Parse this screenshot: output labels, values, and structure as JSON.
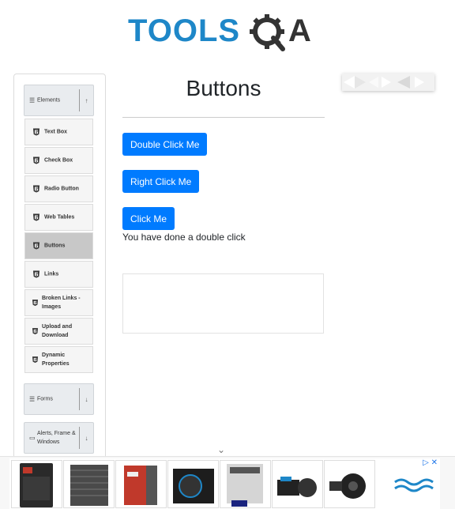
{
  "logo": {
    "text": "TOOLSQA"
  },
  "sidebar": {
    "groups": [
      {
        "label": "Elements",
        "toggle": "↑"
      },
      {
        "label": "Forms",
        "toggle": "↓"
      },
      {
        "label": "Alerts, Frame & Windows",
        "toggle": "↓"
      }
    ],
    "items": [
      {
        "label": "Text Box"
      },
      {
        "label": "Check Box"
      },
      {
        "label": "Radio Button"
      },
      {
        "label": "Web Tables"
      },
      {
        "label": "Buttons"
      },
      {
        "label": "Links"
      },
      {
        "label": "Broken Links - Images"
      },
      {
        "label": "Upload and Download"
      },
      {
        "label": "Dynamic Properties"
      }
    ]
  },
  "main": {
    "title": "Buttons",
    "double_click_label": "Double Click Me",
    "right_click_label": "Right Click Me",
    "click_label": "Click Me",
    "message": "You have done a double click"
  },
  "colors": {
    "primary": "#007bff",
    "logo_blue": "#1e87c8",
    "active_item": "#c8c8c8"
  },
  "icons": [
    "list-icon",
    "html5-shield-icon",
    "chevron-up-icon",
    "chevron-down-icon",
    "ad-choices-icon"
  ]
}
